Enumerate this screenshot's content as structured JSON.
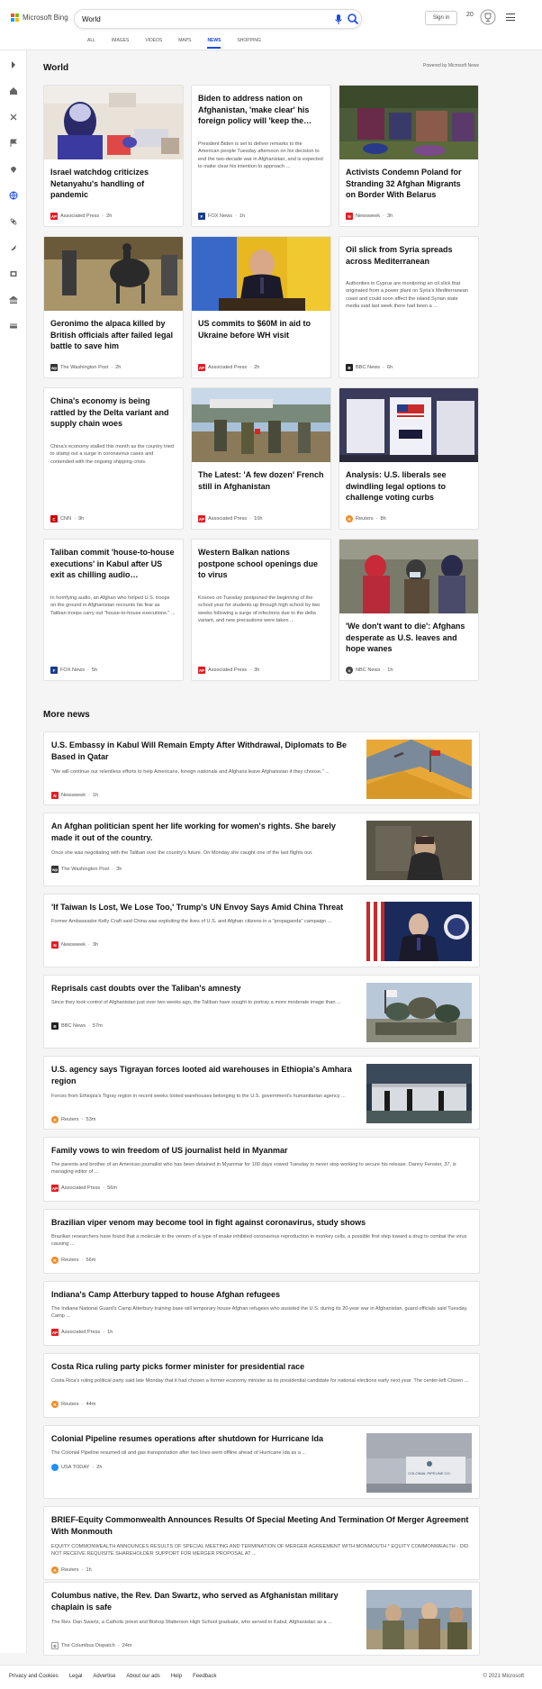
{
  "header": {
    "logo_text": "Microsoft Bing",
    "search_value": "World",
    "signin_label": "Sign in",
    "rewards_count": "20"
  },
  "tabs": [
    "ALL",
    "IMAGES",
    "VIDEOS",
    "MAPS",
    "NEWS",
    "SHOPPING"
  ],
  "active_tab": "NEWS",
  "rail_icons": [
    "chevron-right-icon",
    "home-icon",
    "tools-icon",
    "flag-icon",
    "location-icon",
    "globe-icon",
    "science-icon",
    "rocket-icon",
    "film-icon",
    "bank-icon",
    "card-icon"
  ],
  "world": {
    "title": "World",
    "powered_by": "Powered by Microsoft News",
    "cards": [
      {
        "title": "Israel watchdog criticizes Netanyahu's handling of pandemic",
        "snippet": "",
        "source": "Associated Press",
        "time": "2h",
        "source_icon": "AP",
        "icon_color": "#e11d24"
      },
      {
        "title": "Biden to address nation on Afghanistan, 'make clear' his foreign policy will 'keep the…",
        "snippet": "President Biden is set to deliver remarks to the American people Tuesday afternoon on his decision to end the two-decade war in Afghanistan, and is expected to make clear his intention to approach ...",
        "source": "FOX News",
        "time": "1h",
        "source_icon": "F",
        "icon_color": "#1a3a8a"
      },
      {
        "title": "Activists Condemn Poland for Stranding 32 Afghan Migrants on Border With Belarus",
        "snippet": "",
        "source": "Newsweek",
        "time": "3h",
        "source_icon": "N",
        "icon_color": "#e11d24"
      },
      {
        "title": "Geronimo the alpaca killed by British officials after failed legal battle to save him",
        "snippet": "",
        "source": "The Washington Post",
        "time": "2h",
        "source_icon": "wp",
        "icon_color": "#333333"
      },
      {
        "title": "US commits to $60M in aid to Ukraine before WH visit",
        "snippet": "",
        "source": "Associated Press",
        "time": "2h",
        "source_icon": "AP",
        "icon_color": "#e11d24"
      },
      {
        "title": "Oil slick from Syria spreads across Mediterranean",
        "snippet": "Authorities in Cyprus are monitoring an oil slick that originated from a power plant on Syria's Mediterranean coast and could soon affect the island.Syrian state media said last week there had been a ...",
        "source": "BBC News",
        "time": "6h",
        "source_icon": "B",
        "icon_color": "#222222"
      },
      {
        "title": "China's economy is being rattled by the Delta variant and supply chain woes",
        "snippet": "China's economy stalled this month as the country tried to stamp out a surge in coronavirus cases and contended with the ongoing shipping crisis.",
        "source": "CNN",
        "time": "9h",
        "source_icon": "C",
        "icon_color": "#cc0000"
      },
      {
        "title": "The Latest: 'A few dozen' French still in Afghanistan",
        "snippet": "",
        "source": "Associated Press",
        "time": "10h",
        "source_icon": "AP",
        "icon_color": "#e11d24"
      },
      {
        "title": "Analysis: U.S. liberals see dwindling legal options to challenge voting curbs",
        "snippet": "",
        "source": "Reuters",
        "time": "8h",
        "source_icon": "R",
        "icon_color": "#f28c28"
      },
      {
        "title": "Taliban commit 'house-to-house executions' in Kabul after US exit as chilling audio…",
        "snippet": "In horrifying audio, an Afghan who helped U.S. troops on the ground in Afghanistan recounts his fear as Taliban troops carry out \"house-to-house executions.\" ...",
        "source": "FOX News",
        "time": "5h",
        "source_icon": "F",
        "icon_color": "#1a3a8a"
      },
      {
        "title": "Western Balkan nations postpone school openings due to virus",
        "snippet": "Kosovo on Tuesday postponed the beginning of the school year for students up through high school by two weeks following a surge of infections due to the delta variant, and new precautions were taken ...",
        "source": "Associated Press",
        "time": "3h",
        "source_icon": "AP",
        "icon_color": "#e11d24"
      },
      {
        "title": "'We don't want to die': Afghans desperate as U.S. leaves and hope wanes",
        "snippet": "",
        "source": "NBC News",
        "time": "1h",
        "source_icon": "n",
        "icon_color": "#444444"
      }
    ]
  },
  "more_news": {
    "title": "More news",
    "items": [
      {
        "title": "U.S. Embassy in Kabul Will Remain Empty After Withdrawal, Diplomats to Be Based in Qatar",
        "snippet": "\"We will continue our relentless efforts to help Americans, foreign nationals and Afghans leave Afghanistan if they choose,\" ...",
        "source": "Newsweek",
        "time": "1h",
        "source_icon": "N",
        "icon_color": "#e11d24"
      },
      {
        "title": "An Afghan politician spent her life working for women's rights. She barely made it out of the country.",
        "snippet": "Once she was negotiating with the Taliban over the country's future. On Monday she caught one of the last flights out.",
        "source": "The Washington Post",
        "time": "3h",
        "source_icon": "wp",
        "icon_color": "#333333"
      },
      {
        "title": "'If Taiwan Is Lost, We Lose Too,' Trump's UN Envoy Says Amid China Threat",
        "snippet": "Former Ambassador Kelly Craft said China was exploiting the lives of U.S. and Afghan citizens in a \"propaganda\" campaign ...",
        "source": "Newsweek",
        "time": "3h",
        "source_icon": "N",
        "icon_color": "#e11d24"
      },
      {
        "title": "Reprisals cast doubts over the Taliban's amnesty",
        "snippet": "Since they took control of Afghanistan just over two weeks ago, the Taliban have sought to portray a more moderate image than ...",
        "source": "BBC News",
        "time": "57m",
        "source_icon": "B",
        "icon_color": "#222222"
      },
      {
        "title": "U.S. agency says Tigrayan forces looted aid warehouses in Ethiopia's Amhara region",
        "snippet": "Forces from Ethiopia's Tigray region in recent weeks looted warehouses belonging to the U.S. government's humanitarian agency ...",
        "source": "Reuters",
        "time": "53m",
        "source_icon": "R",
        "icon_color": "#f28c28"
      },
      {
        "title": "Family vows to win freedom of US journalist held in Myanmar",
        "snippet": "The parents and brother of an American journalist who has been detained in Myanmar for 100 days vowed Tuesday to never stop working to secure his release. Danny Fenster, 37, is managing editor of ...",
        "source": "Associated Press",
        "time": "56m",
        "source_icon": "AP",
        "icon_color": "#e11d24"
      },
      {
        "title": "Brazilian viper venom may become tool in fight against coronavirus, study shows",
        "snippet": "Brazilian researchers have found that a molecule in the venom of a type of snake inhibited coronavirus reproduction in monkey cells, a possible first step toward a drug to combat the virus causing ...",
        "source": "Reuters",
        "time": "56m",
        "source_icon": "R",
        "icon_color": "#f28c28"
      },
      {
        "title": "Indiana's Camp Atterbury tapped to house Afghan refugees",
        "snippet": "The Indiana National Guard's Camp Atterbury training base will temporary house Afghan refugees who assisted the U.S. during its 20-year war in Afghanistan, guard officials said Tuesday. Camp ...",
        "source": "Associated Press",
        "time": "1h",
        "source_icon": "AP",
        "icon_color": "#e11d24"
      },
      {
        "title": "Costa Rica ruling party picks former minister for presidential race",
        "snippet": "Costa Rica's ruling political party said late Monday that it had chosen a former economy minister as its presidential candidate for national elections early next year. The center-left Citizen ...",
        "source": "Reuters",
        "time": "44m",
        "source_icon": "R",
        "icon_color": "#f28c28"
      },
      {
        "title": "Colonial Pipeline resumes operations after shutdown for Hurricane Ida",
        "snippet": "The Colonial Pipeline resumed oil and gas transportation after two lines went offline ahead of Hurricane Ida as a ...",
        "source": "USA TODAY",
        "time": "2h",
        "source_icon": "",
        "icon_color": "#1e90ff",
        "thumb_caption": "COLONIAL PIPELINE CO."
      },
      {
        "title": "BRIEF-Equity Commonwealth Announces Results Of Special Meeting And Termination Of Merger Agreement With Monmouth",
        "snippet": "EQUITY COMMONWEALTH ANNOUNCES RESULTS OF SPECIAL MEETING AND TERMINATION OF MERGER AGREEMENT WITH MONMOUTH * EQUITY COMMONWEALTH - DID NOT RECEIVE REQUISITE SHAREHOLDER SUPPORT FOR MERGER PROPOSAL AT ...",
        "source": "Reuters",
        "time": "1h",
        "source_icon": "R",
        "icon_color": "#f28c28"
      },
      {
        "title": "Columbus native, the Rev. Dan Swartz, who served as Afghanistan military chaplain is safe",
        "snippet": "The Rev. Dan Swartz, a Catholic priest and Bishop Watterson High School graduate, who served in Kabul, Afghanistan as a ...",
        "source": "The Columbus Dispatch",
        "time": "24m",
        "source_icon": "D",
        "icon_color": "#444444"
      }
    ]
  },
  "footer": {
    "links": [
      "Privacy and Cookies",
      "Legal",
      "Advertise",
      "About our ads",
      "Help",
      "Feedback"
    ],
    "copyright": "© 2021 Microsoft"
  }
}
